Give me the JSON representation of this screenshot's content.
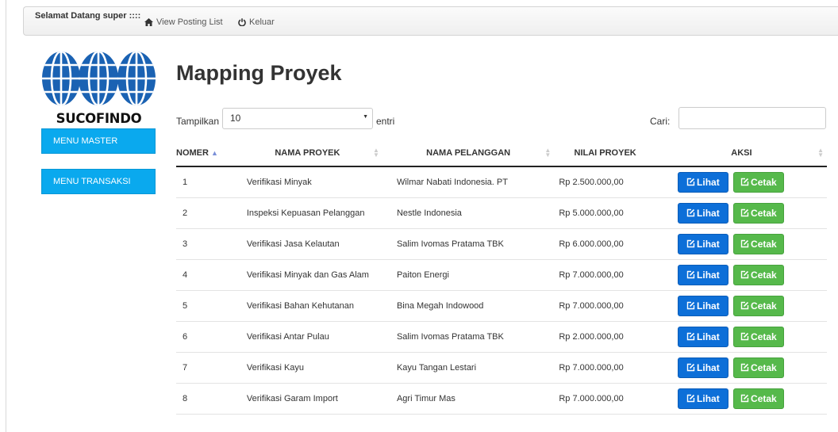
{
  "navbar": {
    "welcome": "Selamat Datang super ::::",
    "links": [
      {
        "label": "View Posting List",
        "icon": "home-icon"
      },
      {
        "label": "Keluar",
        "icon": "power-icon"
      }
    ]
  },
  "sidebar": {
    "logo_text": "SUCOFINDO",
    "menus": [
      {
        "label": "MENU MASTER"
      },
      {
        "label": "MENU TRANSAKSI"
      }
    ]
  },
  "page": {
    "title": "Mapping Proyek"
  },
  "controls": {
    "length_label": "Tampilkan",
    "length_value": "10",
    "length_suffix": "entri",
    "search_label": "Cari:",
    "search_value": ""
  },
  "table": {
    "headers": [
      "NOMER",
      "NAMA PROYEK",
      "NAMA PELANGGAN",
      "NILAI PROYEK",
      "AKSI"
    ],
    "rows": [
      {
        "no": "1",
        "nama": "Verifikasi Minyak",
        "pelanggan": "Wilmar Nabati Indonesia. PT",
        "nilai": "Rp 2.500.000,00"
      },
      {
        "no": "2",
        "nama": "Inspeksi Kepuasan Pelanggan",
        "pelanggan": "Nestle Indonesia",
        "nilai": "Rp 5.000.000,00"
      },
      {
        "no": "3",
        "nama": "Verifikasi Jasa Kelautan",
        "pelanggan": "Salim Ivomas Pratama TBK",
        "nilai": "Rp 6.000.000,00"
      },
      {
        "no": "4",
        "nama": "Verifikasi Minyak dan Gas Alam",
        "pelanggan": "Paiton Energi",
        "nilai": "Rp 7.000.000,00"
      },
      {
        "no": "5",
        "nama": "Verifikasi Bahan Kehutanan",
        "pelanggan": "Bina Megah Indowood",
        "nilai": "Rp 7.000.000,00"
      },
      {
        "no": "6",
        "nama": "Verifikasi Antar Pulau",
        "pelanggan": "Salim Ivomas Pratama TBK",
        "nilai": "Rp 2.000.000,00"
      },
      {
        "no": "7",
        "nama": "Verifikasi Kayu",
        "pelanggan": "Kayu Tangan Lestari",
        "nilai": "Rp 7.000.000,00"
      },
      {
        "no": "8",
        "nama": "Verifikasi Garam Import",
        "pelanggan": "Agri Timur Mas",
        "nilai": "Rp 7.000.000,00"
      }
    ],
    "actions": {
      "view": "Lihat",
      "print": "Cetak"
    }
  },
  "colors": {
    "menu": "#0aa9ee",
    "lihat": "#0d6fd8",
    "cetak": "#56b94b",
    "logo_blue": "#1a62b3"
  }
}
